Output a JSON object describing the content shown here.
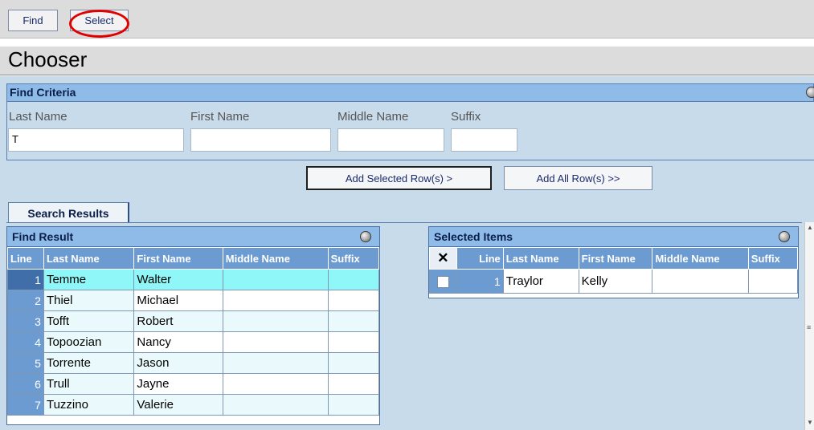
{
  "toolbar": {
    "find_label": "Find",
    "select_label": "Select"
  },
  "page": {
    "title": "Chooser"
  },
  "find_criteria": {
    "heading": "Find Criteria",
    "fields": {
      "last_name": {
        "label": "Last Name",
        "value": "T"
      },
      "first_name": {
        "label": "First Name",
        "value": ""
      },
      "middle_name": {
        "label": "Middle Name",
        "value": ""
      },
      "suffix": {
        "label": "Suffix",
        "value": ""
      }
    }
  },
  "actions": {
    "add_selected": "Add Selected Row(s) >",
    "add_all": "Add All Row(s) >>"
  },
  "tabs": {
    "search_results": "Search Results"
  },
  "find_result": {
    "heading": "Find Result",
    "columns": [
      "Line",
      "Last Name",
      "First Name",
      "Middle Name",
      "Suffix"
    ],
    "rows": [
      {
        "line": "1",
        "last": "Temme",
        "first": "Walter",
        "middle": "",
        "suffix": ""
      },
      {
        "line": "2",
        "last": "Thiel",
        "first": "Michael",
        "middle": "",
        "suffix": ""
      },
      {
        "line": "3",
        "last": "Tofft",
        "first": "Robert",
        "middle": "",
        "suffix": ""
      },
      {
        "line": "4",
        "last": "Topoozian",
        "first": "Nancy",
        "middle": "",
        "suffix": ""
      },
      {
        "line": "5",
        "last": "Torrente",
        "first": "Jason",
        "middle": "",
        "suffix": ""
      },
      {
        "line": "6",
        "last": "Trull",
        "first": "Jayne",
        "middle": "",
        "suffix": ""
      },
      {
        "line": "7",
        "last": "Tuzzino",
        "first": "Valerie",
        "middle": "",
        "suffix": ""
      }
    ]
  },
  "selected_items": {
    "heading": "Selected Items",
    "remove_symbol": "✕",
    "columns": [
      "Line",
      "Last Name",
      "First Name",
      "Middle Name",
      "Suffix"
    ],
    "rows": [
      {
        "line": "1",
        "last": "Traylor",
        "first": "Kelly",
        "middle": "",
        "suffix": ""
      }
    ]
  },
  "icons": {
    "collapse": "collapse-chevron-icon",
    "remove": "remove-x-icon"
  },
  "colors": {
    "header_blue": "#8ebbe8",
    "column_header": "#6c9bd2",
    "selected_row": "#8ff7f7",
    "highlight_circle": "#e10000"
  }
}
